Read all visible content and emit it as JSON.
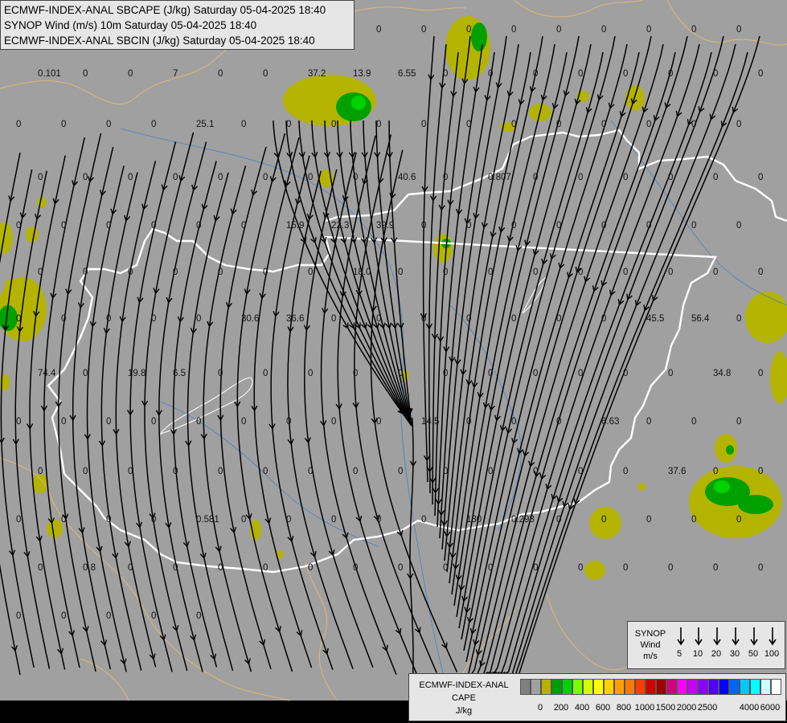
{
  "title_lines": [
    "ECMWF-INDEX-ANAL SBCAPE (J/kg) Saturday 05-04-2025 18:40",
    "SYNOP Wind (m/s) 10m Saturday 05-04-2025 18:40",
    "ECMWF-INDEX-ANAL SBCIN (J/kg) Saturday 05-04-2025 18:40"
  ],
  "wind_legend": {
    "title_lines": [
      "SYNOP",
      "Wind",
      "m/s"
    ],
    "speeds": [
      "5",
      "10",
      "20",
      "30",
      "50",
      "100"
    ]
  },
  "cape_legend": {
    "title_lines": [
      "ECMWF-INDEX-ANAL",
      "CAPE",
      "J/kg"
    ],
    "colors": [
      "#808080",
      "#a0a0a0",
      "#b4b400",
      "#00a000",
      "#00d200",
      "#78ff00",
      "#d2ff00",
      "#ffff00",
      "#ffd200",
      "#ffa000",
      "#ff7800",
      "#ff3c00",
      "#d20000",
      "#a00000",
      "#d2007c",
      "#ff00ff",
      "#c800ff",
      "#8c00ff",
      "#5000ff",
      "#0000ff",
      "#0064ff",
      "#00c8ff",
      "#00ffff",
      "#c8ffff",
      "#ffffff"
    ],
    "ticks": [
      "0",
      "200",
      "400",
      "600",
      "800",
      "1000",
      "1500",
      "2000",
      "2500",
      "4000",
      "6000"
    ]
  },
  "map_values": [
    "0",
    "0",
    "0",
    "0",
    "0",
    "0",
    "0",
    "0",
    "0",
    "0.101",
    "0",
    "0",
    "7",
    "0",
    "0",
    "37.2",
    "13.9",
    "6.55",
    "0",
    "0",
    "0",
    "0",
    "0",
    "0",
    "0",
    "0",
    "0",
    "0",
    "0",
    "0",
    "25.1",
    "0",
    "0",
    "0",
    "0",
    "0",
    "0",
    "0",
    "0",
    "0",
    "0",
    "0",
    "0",
    "0",
    "0",
    "0",
    "0",
    "0",
    "0",
    "0",
    "0",
    "40.6",
    "0",
    "0.807",
    "0",
    "0",
    "0",
    "0",
    "0",
    "0",
    "0",
    "0",
    "0",
    "0",
    "0",
    "0",
    "15.9",
    "22.3",
    "39.9",
    "0",
    "0",
    "0",
    "0",
    "0",
    "0",
    "0",
    "0",
    "0",
    "0",
    "0",
    "0",
    "0",
    "0",
    "0",
    "18.0",
    "0",
    "0",
    "0",
    "0",
    "0",
    "0",
    "0",
    "0",
    "0",
    "0",
    "0",
    "0",
    "0",
    "0",
    "30.6",
    "36.6",
    "0",
    "0",
    "0",
    "0",
    "0",
    "0",
    "0",
    "45.5",
    "56.4",
    "0",
    "74.4",
    "0",
    "19.8",
    "6.5",
    "0",
    "0",
    "0",
    "0",
    "0",
    "0",
    "0",
    "0",
    "0",
    "0",
    "0",
    "34.8",
    "0",
    "0",
    "0",
    "0",
    "0",
    "0",
    "0",
    "0",
    "0",
    "0",
    "14.5",
    "0",
    "0",
    "0",
    "6.63",
    "0",
    "0",
    "0",
    "0",
    "0",
    "0",
    "0",
    "0",
    "0",
    "0",
    "0",
    "0",
    "0",
    "0",
    "0",
    "0",
    "0",
    "37.6",
    "0",
    "0",
    "0",
    "0",
    "0",
    "0",
    "0.581",
    "0",
    "0",
    "0",
    "0",
    "0",
    "130",
    "0.293",
    "0",
    "0",
    "0",
    "0",
    "0",
    "0",
    "0.8",
    "0",
    "0",
    "0",
    "0",
    "0",
    "0",
    "0",
    "0",
    "0",
    "0",
    "0",
    "0",
    "0",
    "0",
    "0",
    "0",
    "0",
    "0",
    "0",
    "0"
  ]
}
